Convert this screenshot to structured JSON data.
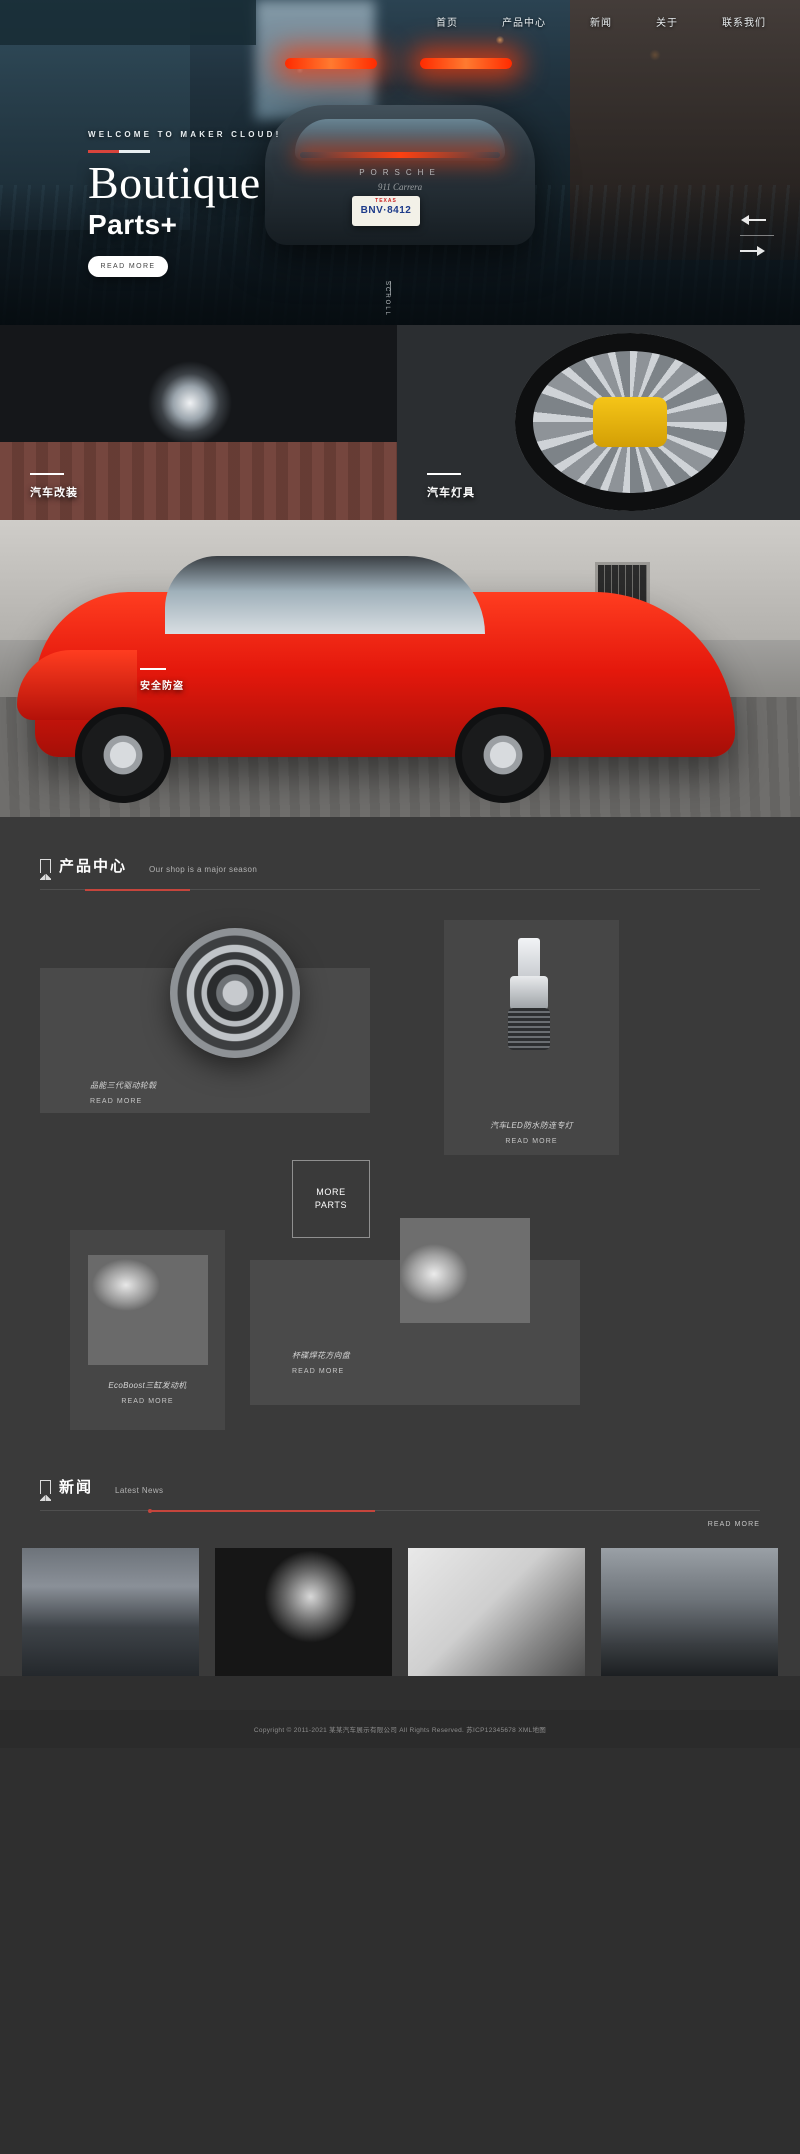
{
  "header": {
    "nav": [
      {
        "label": "首页",
        "name": "nav-home"
      },
      {
        "label": "产品中心",
        "name": "nav-products"
      },
      {
        "label": "新闻",
        "name": "nav-news"
      },
      {
        "label": "关于",
        "name": "nav-about"
      },
      {
        "label": "联系我们",
        "name": "nav-contact"
      }
    ]
  },
  "hero": {
    "welcome": "WELCOME TO MAKER CLOUD!",
    "title_serif": "Boutique",
    "title_bold": "Parts+",
    "cta": "READ MORE",
    "scroll": "SCROLL",
    "plate_state": "TEXAS",
    "plate_number": "BNV·8412",
    "brand": "PORSCHE",
    "model": "911 Carrera"
  },
  "categories": [
    {
      "label": "汽车改装"
    },
    {
      "label": "汽车灯具"
    }
  ],
  "banner": {
    "label": "安全防盗"
  },
  "products": {
    "title": "产品中心",
    "subtitle": "Our shop is a major season",
    "more_line1": "MORE",
    "more_line2": "PARTS",
    "read_more": "READ MORE",
    "items": [
      {
        "label": "品能三代驱动轮毂",
        "read_more": "READ MORE"
      },
      {
        "label": "汽车LED防水防连专灯",
        "read_more": "READ MORE"
      },
      {
        "label": "EcoBoost三缸发动机",
        "read_more": "READ MORE"
      },
      {
        "label": "杯碟焊花方向盘",
        "read_more": "READ MORE"
      }
    ]
  },
  "news": {
    "title": "新闻",
    "subtitle": "Latest News",
    "read_more": "READ MORE",
    "cards": [
      {
        "name": "news-card-1"
      },
      {
        "name": "news-card-2"
      },
      {
        "name": "news-card-3"
      },
      {
        "name": "news-card-4"
      }
    ]
  },
  "footer": {
    "copyright": "Copyright © 2011-2021 某某汽车展示有限公司 All Rights Reserved.   苏ICP12345678  XML地图"
  },
  "colors": {
    "accent": "#c5453c",
    "bg": "#3a3a3a",
    "footer_bg": "#2b2b2b"
  }
}
